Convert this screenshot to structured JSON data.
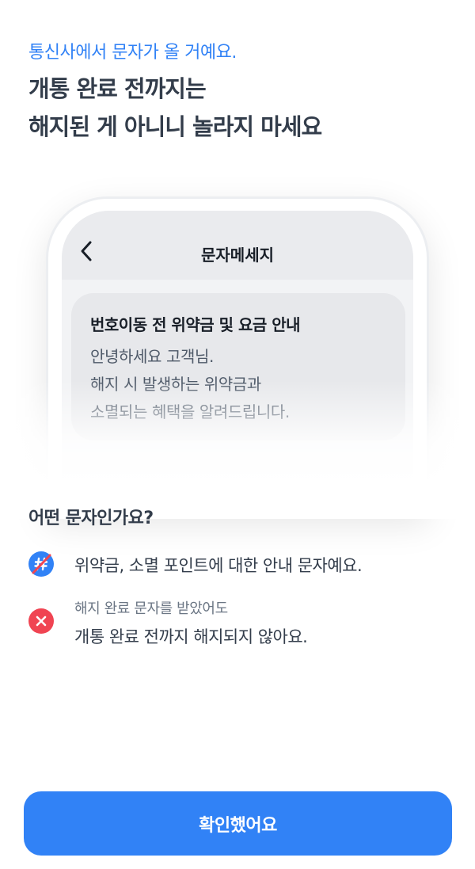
{
  "header": {
    "eyebrow": "통신사에서 문자가 올 거예요.",
    "title_line1": "개통 완료 전까지는",
    "title_line2": "해지된 게 아니니 놀라지 마세요"
  },
  "phone_preview": {
    "screen_title": "문자메세지",
    "back_icon": "chevron-left-icon",
    "message": {
      "title": "번호이동 전 위약금 및 요금 안내",
      "lines": [
        "안녕하세요 고객님.",
        "해지 시 발생하는 위약금과",
        "소멸되는 혜택을 알려드립니다."
      ]
    }
  },
  "info": {
    "title": "어떤 문자인가요?",
    "items": [
      {
        "icon": "no-hashtag-icon",
        "color": "#3182f6",
        "text": "위약금, 소멸 포인트에 대한 안내 문자예요."
      },
      {
        "icon": "close-icon",
        "color": "#f04452",
        "subtext": "해지 완료 문자를 받았어도",
        "text": "개통 완료 전까지 해지되지 않아요."
      }
    ]
  },
  "footer": {
    "confirm_label": "확인했어요",
    "accent": "#3182f6"
  }
}
